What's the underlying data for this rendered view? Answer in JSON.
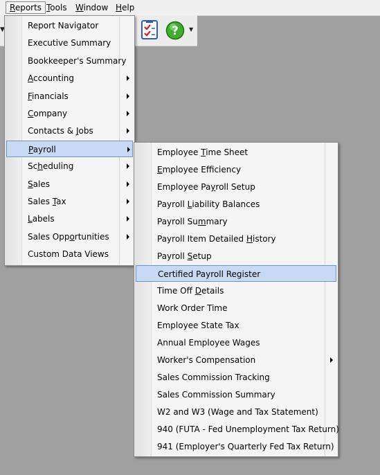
{
  "menubar": {
    "reports": {
      "mnemonic": "R",
      "rest": "eports"
    },
    "tools": {
      "mnemonic": "T",
      "rest": "ools"
    },
    "window": {
      "mnemonic": "W",
      "rest": "indow"
    },
    "help": {
      "mnemonic": "H",
      "rest": "elp"
    }
  },
  "reports_menu": [
    {
      "pre": "Report Navigator",
      "u": "",
      "post": "",
      "submenu": false
    },
    {
      "pre": "Executive Summary",
      "u": "",
      "post": "",
      "submenu": false
    },
    {
      "pre": "Bookkeeper's Summary",
      "u": "",
      "post": "",
      "submenu": false
    },
    {
      "pre": "",
      "u": "A",
      "post": "ccounting",
      "submenu": true
    },
    {
      "pre": "",
      "u": "F",
      "post": "inancials",
      "submenu": true
    },
    {
      "pre": "",
      "u": "C",
      "post": "ompany",
      "submenu": true
    },
    {
      "pre": "Contacts & ",
      "u": "J",
      "post": "obs",
      "submenu": true
    },
    {
      "pre": "",
      "u": "P",
      "post": "ayroll",
      "submenu": true
    },
    {
      "pre": "Sc",
      "u": "h",
      "post": "eduling",
      "submenu": true
    },
    {
      "pre": "",
      "u": "S",
      "post": "ales",
      "submenu": true
    },
    {
      "pre": "Sales ",
      "u": "T",
      "post": "ax",
      "submenu": true
    },
    {
      "pre": "",
      "u": "L",
      "post": "abels",
      "submenu": true
    },
    {
      "pre": "Sales Opp",
      "u": "o",
      "post": "rtunities",
      "submenu": true
    },
    {
      "pre": "Custom Data Views",
      "u": "",
      "post": "",
      "submenu": false
    }
  ],
  "payroll_menu": [
    {
      "pre": "Employee ",
      "u": "T",
      "post": "ime Sheet",
      "submenu": false
    },
    {
      "pre": "",
      "u": "E",
      "post": "mployee Efficiency",
      "submenu": false
    },
    {
      "pre": "Employee Pa",
      "u": "y",
      "post": "roll Setup",
      "submenu": false
    },
    {
      "pre": "Payroll ",
      "u": "L",
      "post": "iability Balances",
      "submenu": false
    },
    {
      "pre": "Payroll Su",
      "u": "m",
      "post": "mary",
      "submenu": false
    },
    {
      "pre": "Payroll Item Detailed ",
      "u": "H",
      "post": "istory",
      "submenu": false
    },
    {
      "pre": "Payroll ",
      "u": "S",
      "post": "etup",
      "submenu": false
    },
    {
      "pre": "Certified Payroll Register",
      "u": "",
      "post": "",
      "submenu": false
    },
    {
      "pre": "Time Off ",
      "u": "D",
      "post": "etails",
      "submenu": false
    },
    {
      "pre": "Work Order Time",
      "u": "",
      "post": "",
      "submenu": false
    },
    {
      "pre": "Employee State Tax",
      "u": "",
      "post": "",
      "submenu": false
    },
    {
      "pre": "Annual Employee Wages",
      "u": "",
      "post": "",
      "submenu": false
    },
    {
      "pre": "Worker's Compensation",
      "u": "",
      "post": "",
      "submenu": true
    },
    {
      "pre": "Sales Commission Tracking",
      "u": "",
      "post": "",
      "submenu": false
    },
    {
      "pre": "Sales Commission Summary",
      "u": "",
      "post": "",
      "submenu": false
    },
    {
      "pre": "W2 and W3 (Wage and Tax Statement)",
      "u": "",
      "post": "",
      "submenu": false
    },
    {
      "pre": "940 (FUTA - Fed Unemployment Tax Return)",
      "u": "",
      "post": "",
      "submenu": false
    },
    {
      "pre": "941 (Employer's Quarterly Fed Tax Return)",
      "u": "",
      "post": "",
      "submenu": false
    }
  ],
  "colors": {
    "highlight": "#c7d9f3",
    "highlight_border": "#6d93cc",
    "menu_bg": "#f5f5f5",
    "desktop": "#a0a0a0"
  },
  "icons": {
    "toolbar_checklist": "checklist-icon",
    "toolbar_help": "help-icon"
  }
}
